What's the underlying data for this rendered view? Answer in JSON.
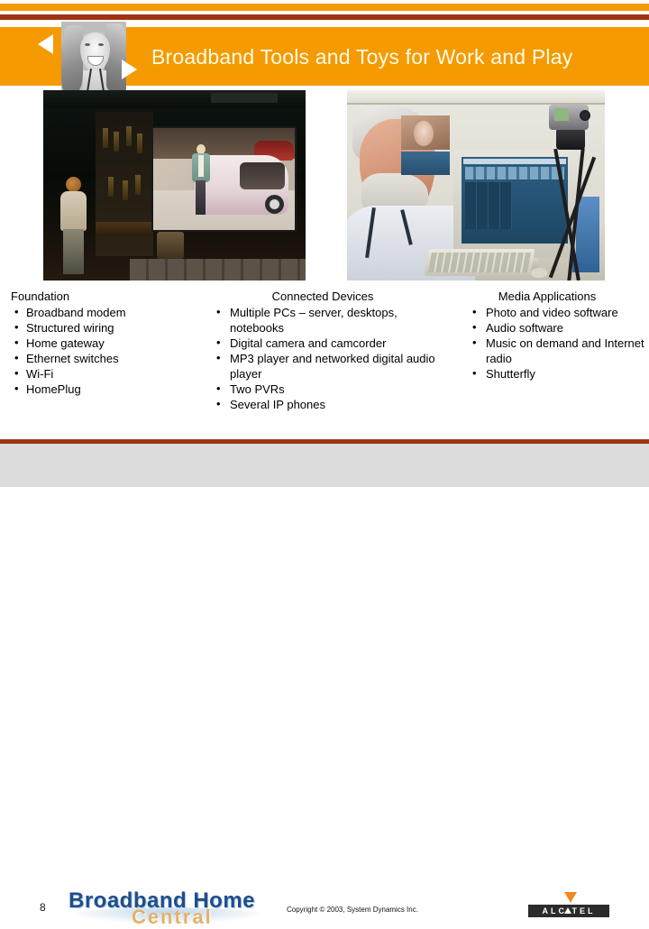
{
  "slide": {
    "title": "Broadband Tools and Toys for Work and Play",
    "page_number": "8",
    "accent_orange": "#f59a00",
    "accent_dark_red": "#9e3413",
    "title_color": "#fffbe6"
  },
  "header": {
    "photo_alt": "smiling-woman-photo",
    "arrow_left": "left-arrow",
    "arrow_right": "right-arrow"
  },
  "images": [
    {
      "name": "home-theater-photo",
      "caption": "Dark home theater room with person standing beside large projection screen showing a car show"
    },
    {
      "name": "video-editing-photo",
      "caption": "Bearded man at CRT monitor running video editing software with camcorder on tripod"
    }
  ],
  "columns": [
    {
      "title": "Foundation",
      "items": [
        "Broadband modem",
        "Structured wiring",
        "Home gateway",
        "Ethernet switches",
        "Wi-Fi",
        "HomePlug"
      ]
    },
    {
      "title": "Connected Devices",
      "items": [
        "Multiple PCs – server, desktops, notebooks",
        "Digital camera and camcorder",
        "MP3 player and networked digital audio player",
        "Two PVRs",
        "Several IP phones"
      ]
    },
    {
      "title": "Media Applications",
      "items": [
        "Photo and video software",
        "Audio software",
        "Music on demand and Internet radio",
        "Shutterfly"
      ]
    }
  ],
  "footer": {
    "logo_line1": "Broadband Home",
    "logo_line2": "Central",
    "copyright": "Copyright © 2003, System Dynamics Inc.",
    "sponsor": "ALC TEL",
    "sponsor_full": "ALCATEL"
  }
}
